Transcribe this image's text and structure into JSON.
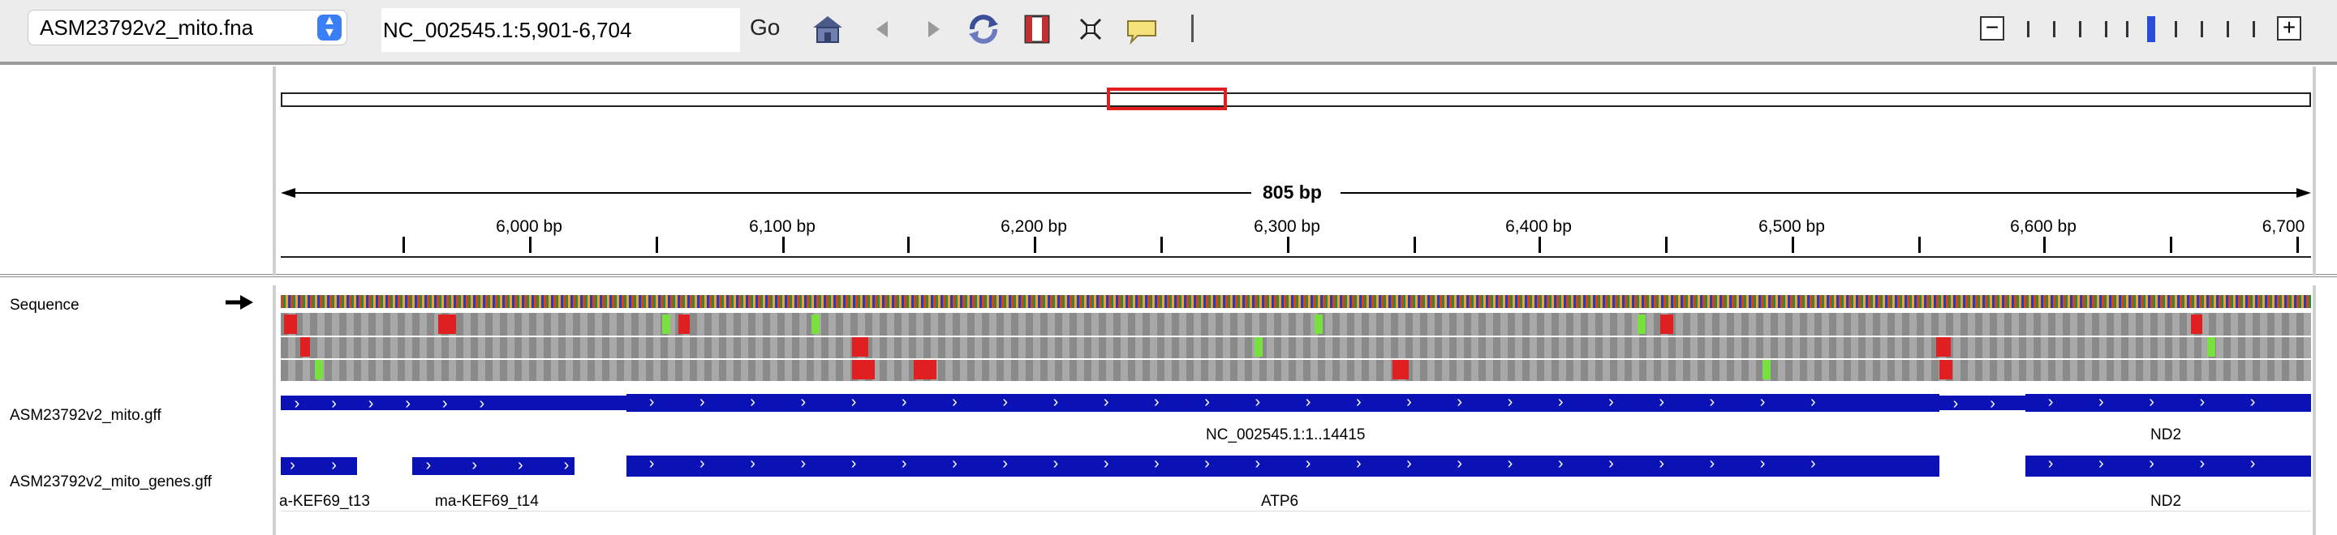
{
  "toolbar": {
    "genome": "ASM23792v2_mito.fna",
    "locus": "NC_002545.1:5,901-6,704",
    "go_label": "Go",
    "icons": [
      "home-icon",
      "back-icon",
      "forward-icon",
      "refresh-icon",
      "roi-icon",
      "fit-window-icon",
      "popup-info-icon"
    ]
  },
  "zoom": {
    "levels": 11,
    "current_index": 6
  },
  "ruler": {
    "span_label": "805 bp",
    "ticks": [
      "6,000 bp",
      "6,100 bp",
      "6,200 bp",
      "6,300 bp",
      "6,400 bp",
      "6,500 bp",
      "6,600 bp",
      "6,700"
    ]
  },
  "tracks": {
    "sequence": "Sequence",
    "mito_gff": "ASM23792v2_mito.gff",
    "mito_genes_gff": "ASM23792v2_mito_genes.gff"
  },
  "features": {
    "mito_gff_labels": [
      "NC_002545.1:1..14415",
      "ND2"
    ],
    "genes_labels": [
      "a-KEF69_t13",
      "ma-KEF69_t14",
      "ATP6",
      "ND2"
    ]
  },
  "colors": {
    "feature": "#0a12b5",
    "roi": "#e02020",
    "zoom": "#2a4cd6"
  }
}
